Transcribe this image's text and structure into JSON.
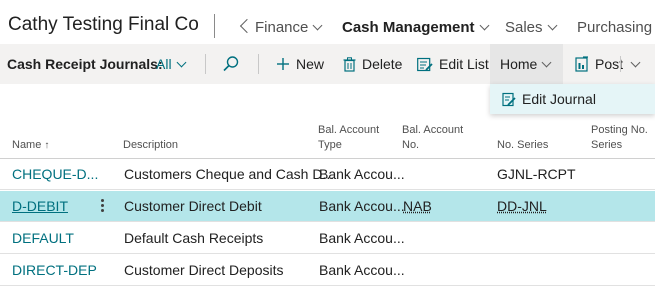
{
  "topnav": {
    "company": "Cathy Testing Final Co",
    "items": [
      {
        "label": "Finance"
      },
      {
        "label": "Cash Management"
      },
      {
        "label": "Sales"
      },
      {
        "label": "Purchasing"
      }
    ]
  },
  "actionbar": {
    "title": "Cash Receipt Journals:",
    "filter": "All",
    "new_label": "New",
    "delete_label": "Delete",
    "edit_list_label": "Edit List",
    "home_label": "Home",
    "post_label": "Post"
  },
  "dropdown": {
    "items": [
      {
        "label": "Edit Journal"
      }
    ]
  },
  "table": {
    "headers": {
      "name": "Name",
      "name_sort": "↑",
      "description": "Description",
      "bal_account_type": [
        "Bal. Account",
        "Type"
      ],
      "bal_account_no": [
        "Bal. Account",
        "No."
      ],
      "no_series": "No. Series",
      "posting_no_series": [
        "Posting No.",
        "Series"
      ]
    },
    "rows": [
      {
        "name": "CHEQUE-D...",
        "description": "Customers Cheque and Cash D...",
        "bal_type": "Bank Accou...",
        "bal_no": "",
        "no_series": "GJNL-RCPT",
        "posting_no_series": "",
        "selected": false
      },
      {
        "name": "D-DEBIT",
        "description": "Customer Direct Debit",
        "bal_type": "Bank Accou...",
        "bal_no": "NAB",
        "no_series": "DD-JNL",
        "posting_no_series": "",
        "selected": true
      },
      {
        "name": "DEFAULT",
        "description": "Default Cash Receipts",
        "bal_type": "Bank Accou...",
        "bal_no": "",
        "no_series": "",
        "posting_no_series": "",
        "selected": false
      },
      {
        "name": "DIRECT-DEP",
        "description": "Customer Direct Deposits",
        "bal_type": "Bank Accou...",
        "bal_no": "",
        "no_series": "",
        "posting_no_series": "",
        "selected": false
      }
    ]
  },
  "colors": {
    "accent": "#00707f",
    "selected_row": "#b4e6ea",
    "dropdown_bg": "#e5f5f7",
    "actionbar_bg": "#f3f2f1"
  }
}
